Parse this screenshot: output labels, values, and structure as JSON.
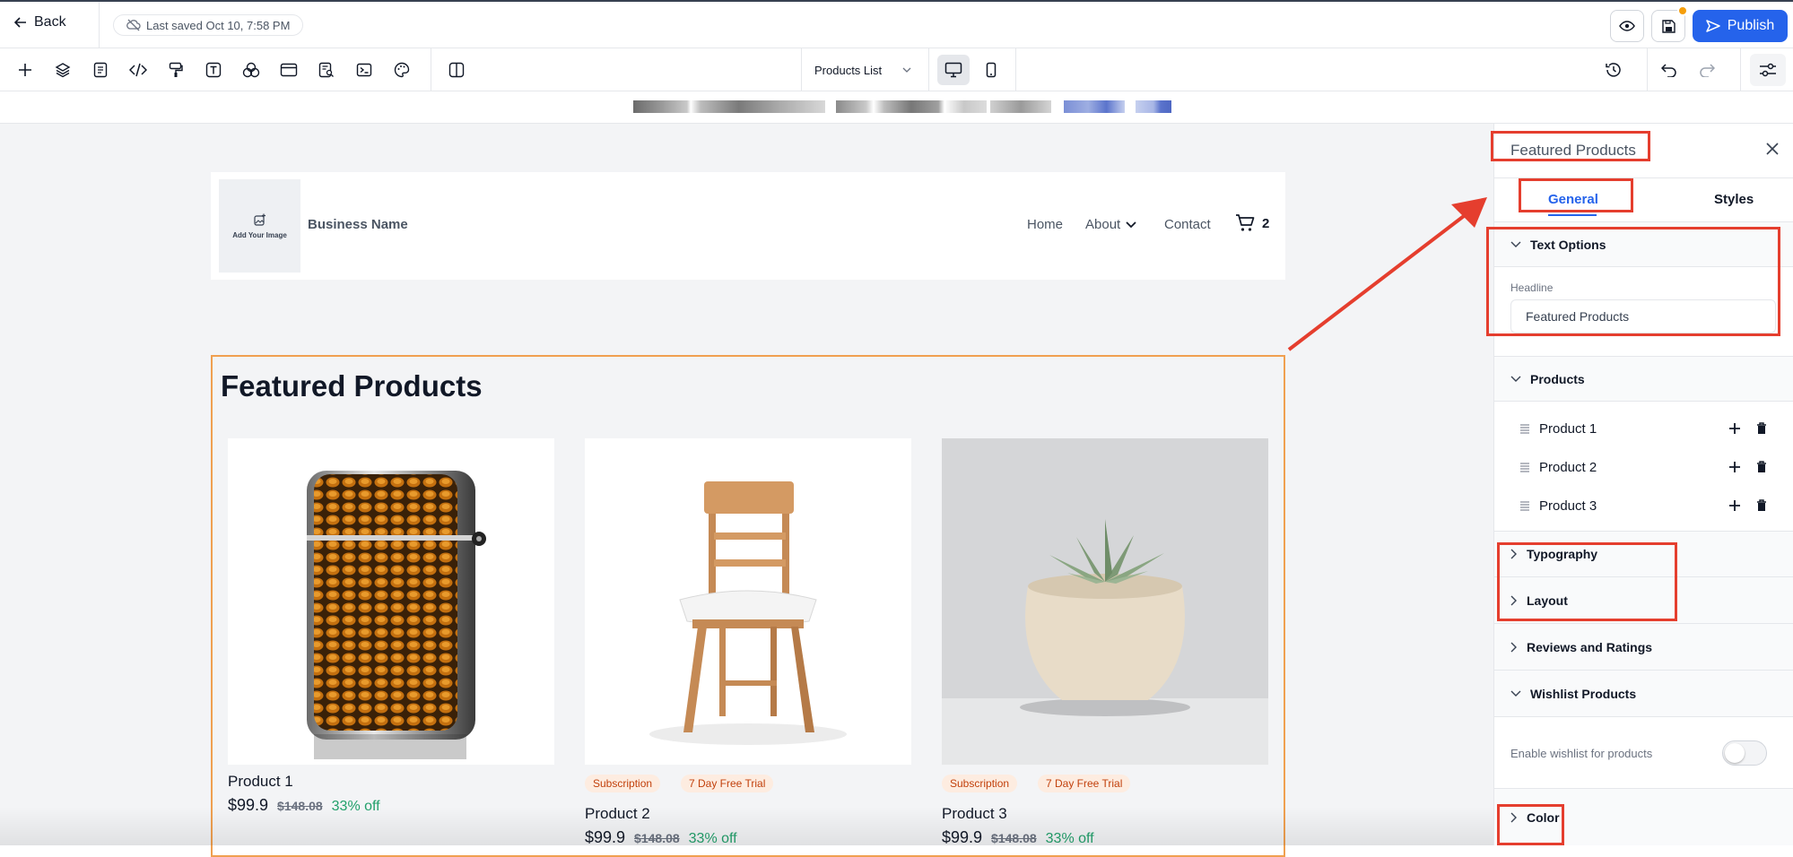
{
  "topbar": {
    "back_label": "Back",
    "saved_text": "Last saved Oct 10, 7:58 PM",
    "publish_label": "Publish"
  },
  "toolbar": {
    "tools": [
      "add-icon",
      "layers-icon",
      "page-icon",
      "code-icon",
      "paint-icon",
      "text-icon",
      "components-icon",
      "section-icon",
      "form-icon",
      "terminal-icon",
      "palette-icon",
      "split-view-icon"
    ],
    "page_select": "Products List"
  },
  "site": {
    "logo_caption": "Add Your Image",
    "business_name": "Business Name",
    "nav": [
      "Home",
      "About",
      "Contact"
    ],
    "cart_count": "2"
  },
  "section": {
    "title": "Featured Products",
    "products": [
      {
        "name": "Product 1",
        "price": "$99.9",
        "old_price": "$148.08",
        "discount": "33% off",
        "badges": []
      },
      {
        "name": "Product 2",
        "price": "$99.9",
        "old_price": "$148.08",
        "discount": "33% off",
        "badges": [
          "Subscription",
          "7 Day Free Trial"
        ]
      },
      {
        "name": "Product 3",
        "price": "$99.9",
        "old_price": "$148.08",
        "discount": "33% off",
        "badges": [
          "Subscription",
          "7 Day Free Trial"
        ]
      }
    ]
  },
  "panel": {
    "title": "Featured Products",
    "tabs": {
      "general": "General",
      "styles": "Styles"
    },
    "text_options": {
      "heading": "Text Options",
      "headline_label": "Headline",
      "headline_value": "Featured Products"
    },
    "products": {
      "heading": "Products",
      "items": [
        "Product 1",
        "Product 2",
        "Product 3"
      ]
    },
    "sections": {
      "typography": "Typography",
      "layout": "Layout",
      "reviews": "Reviews and Ratings",
      "wishlist": "Wishlist Products",
      "color": "Color"
    },
    "wishlist_label": "Enable wishlist for products",
    "wishlist_enabled": false
  },
  "colors": {
    "accent": "#2563eb",
    "annotation": "#e53e2e",
    "selection": "#f0a050",
    "discount": "#22a06b"
  }
}
